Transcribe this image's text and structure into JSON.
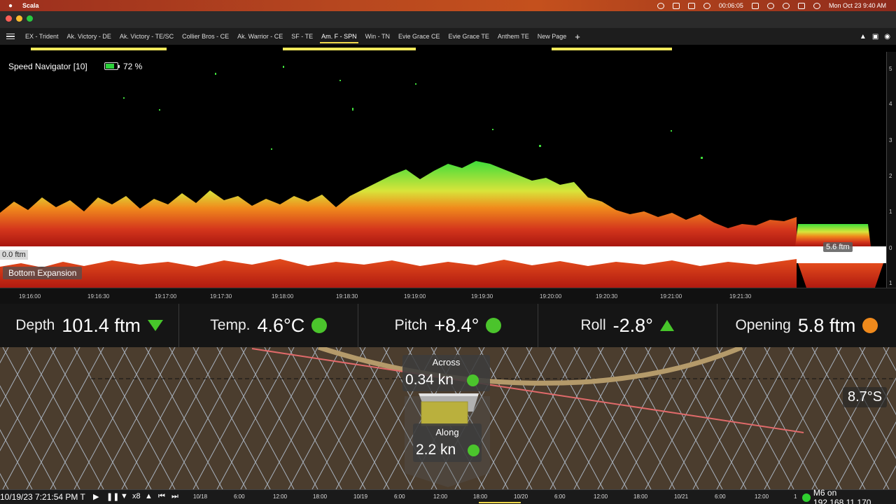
{
  "menubar": {
    "apple_icon": "apple-logo",
    "app_name": "Scala",
    "clock": "00:06:05",
    "date_time": "Mon Oct 23  9:40 AM"
  },
  "tabs": [
    {
      "label": "EX - Trident"
    },
    {
      "label": "Ak. Victory - DE"
    },
    {
      "label": "Ak. Victory - TE/SC"
    },
    {
      "label": "Collier Bros - CE"
    },
    {
      "label": "Ak. Warrior - CE"
    },
    {
      "label": "SF - TE"
    },
    {
      "label": "Am. F - SPN",
      "active": true
    },
    {
      "label": "Win - TN"
    },
    {
      "label": "Evie Grace CE"
    },
    {
      "label": "Evie Grace TE"
    },
    {
      "label": "Anthem TE"
    },
    {
      "label": "New Page"
    }
  ],
  "tab_add": "+",
  "sonar": {
    "title": "Speed Navigator [10]",
    "battery_pct": "72 %",
    "battery_level": 0.72,
    "zero_label": "0.0 ftm",
    "bottom_expansion": "Bottom Expansion",
    "opening_marker": "5.6 ftm",
    "scale_ticks": [
      "5",
      "4",
      "3",
      "2",
      "1",
      "0",
      "1"
    ],
    "scale_unit": "ft",
    "time_ticks": [
      "19:16:00",
      "19:16:30",
      "19:17:00",
      "19:17:30",
      "19:18:00",
      "19:18:30",
      "19:19:00",
      "19:19:30",
      "19:20:00",
      "19:20:30",
      "19:21:00",
      "19:21:30"
    ]
  },
  "readouts": {
    "depth": {
      "label": "Depth",
      "value": "101.4 ftm",
      "indicator": "triangle-down",
      "color": "#47c62a"
    },
    "temp": {
      "label": "Temp.",
      "value": "4.6°C",
      "indicator": "dot",
      "color": "#4bc42c"
    },
    "pitch": {
      "label": "Pitch",
      "value": "+8.4°",
      "indicator": "dot",
      "color": "#4bc42c"
    },
    "roll": {
      "label": "Roll",
      "value": "-2.8°",
      "indicator": "triangle-up",
      "color": "#47c62a"
    },
    "opening": {
      "label": "Opening",
      "value": "5.8 ftm",
      "indicator": "dot",
      "color": "#f08a1c"
    }
  },
  "trawl": {
    "across_label": "Across",
    "across_value": "0.34 kn",
    "along_label": "Along",
    "along_value": "2.2 kn",
    "heel": "8.7°S"
  },
  "timeline": {
    "timestamp": "10/19/23 7:21:54 PM T",
    "speed": "x8",
    "ticks": [
      "10/18",
      "6:00",
      "12:00",
      "18:00",
      "10/19",
      "6:00",
      "12:00",
      "18:00",
      "10/20",
      "6:00",
      "12:00",
      "18:00",
      "10/21",
      "6:00",
      "12:00",
      "1"
    ],
    "connection": "M6 on 192.168.11.170",
    "connection_color": "#2fcf2f"
  }
}
